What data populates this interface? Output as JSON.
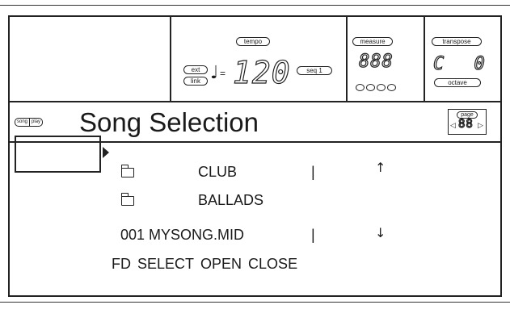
{
  "panel": {
    "tempo_label": "tempo",
    "ext_label": "ext",
    "link_label": "link",
    "tempo_eq": "=",
    "tempo_value": "120",
    "seq_label": "seq 1",
    "measure_label": "measure",
    "measure_value": "888",
    "transpose_label": "transpose",
    "transpose_value": "C 0",
    "octave_label": "octave"
  },
  "header": {
    "mode_song": "song",
    "mode_play": "play",
    "title": "Song Selection",
    "page_label": "page",
    "page_value": "88"
  },
  "list": {
    "items": [
      {
        "type": "folder",
        "label": "CLUB"
      },
      {
        "type": "folder",
        "label": "BALLADS"
      },
      {
        "type": "file",
        "label": "001 MYSONG.MID"
      }
    ],
    "separator": "|",
    "scroll_up": "↑",
    "scroll_down": "↓"
  },
  "buttons": {
    "fd": "FD",
    "select": "SELECT",
    "open": "OPEN",
    "close": "CLOSE"
  }
}
